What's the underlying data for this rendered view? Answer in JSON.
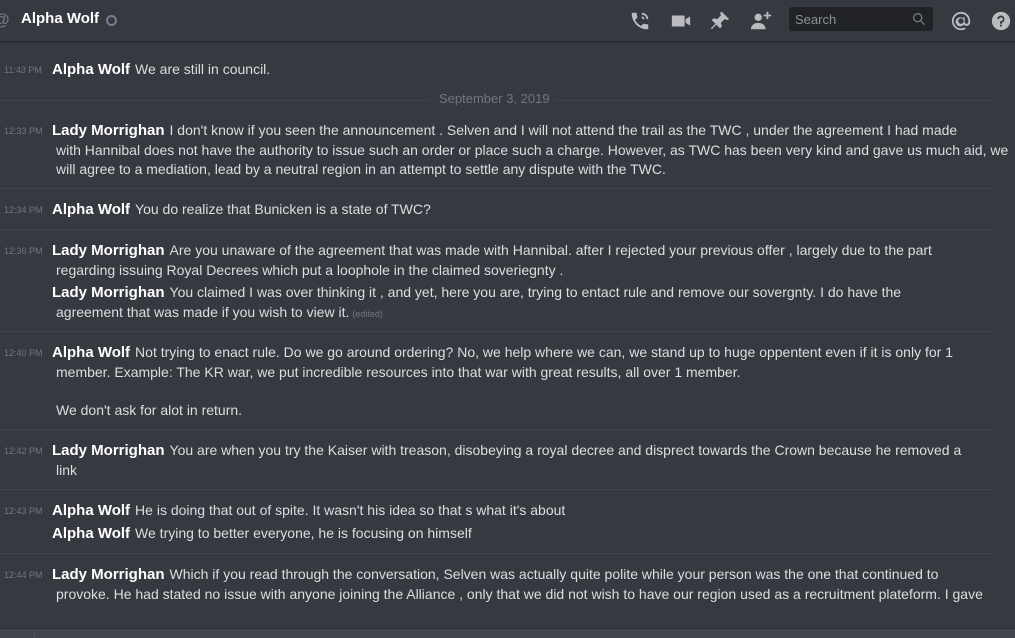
{
  "header": {
    "at_symbol": "@",
    "title": "Alpha Wolf",
    "search_placeholder": "Search",
    "icons": [
      "call-icon",
      "video-icon",
      "pin-icon",
      "add-member-icon",
      "search-icon",
      "mention-icon",
      "help-icon"
    ]
  },
  "messages": {
    "g1": {
      "time": "11:43 PM",
      "author": "Alpha Wolf",
      "text": "We are still in council."
    },
    "date_separator": "September 3, 2019",
    "g2": {
      "time": "12:33 PM",
      "author": "Lady Morrighan",
      "l1": "I don't know if you seen the announcement . Selven and I will not attend the trail as the TWC , under the agreement I had made",
      "l2": "with Hannibal does not have the authority to issue such an order or place such a charge. However, as TWC has been very kind and gave us much aid, we",
      "l3": "will agree to a mediation, lead by a neutral region in an attempt to settle any dispute with the TWC."
    },
    "g3": {
      "time": "12:34 PM",
      "author": "Alpha Wolf",
      "text": "You do realize that Bunicken is a state of TWC?"
    },
    "g4": {
      "time": "12:36 PM",
      "author": "Lady Morrighan",
      "l1": "Are you unaware of the agreement that was made with Hannibal. after I rejected your previous offer , largely due to the part",
      "l2": "regarding issuing Royal Decrees which put a loophole in the claimed soveriegnty .",
      "m2_author": "Lady Morrighan",
      "m2_l1": "You claimed I was over thinking it , and yet, here you are, trying to entact rule and remove our sovergnty. I do have the",
      "m2_l2": "agreement that was made if you wish to view it.",
      "edited": "(edited)"
    },
    "g5": {
      "time": "12:40 PM",
      "author": "Alpha Wolf",
      "l1": "Not trying to enact rule. Do we go around ordering? No, we help where we can, we stand up to huge oppentent even if it is only for 1",
      "l2": "member. Example: The KR war, we put incredible resources into that war with great results, all over 1 member.",
      "l3": "We don't ask for alot in return."
    },
    "g6": {
      "time": "12:42 PM",
      "author": "Lady Morrighan",
      "l1": "You are when you try the Kaiser with treason, disobeying a royal decree and disprect towards the Crown because he removed a",
      "l2": "link"
    },
    "g7": {
      "time": "12:43 PM",
      "author": "Alpha Wolf",
      "text": "He is doing that out of spite. It wasn't his idea so that s what it's about",
      "m2_author": "Alpha Wolf",
      "m2_text": "We trying to better everyone, he is focusing on himself"
    },
    "g8": {
      "time": "12:44 PM",
      "author": "Lady Morrighan",
      "l1": "Which if you read through the conversation, Selven was actually quite polite while your person was the one that continued to",
      "l2": "provoke. He had stated no issue with anyone joining the Alliance , only that we did not wish to have our region used as a recruitment plateform. I gave"
    }
  }
}
